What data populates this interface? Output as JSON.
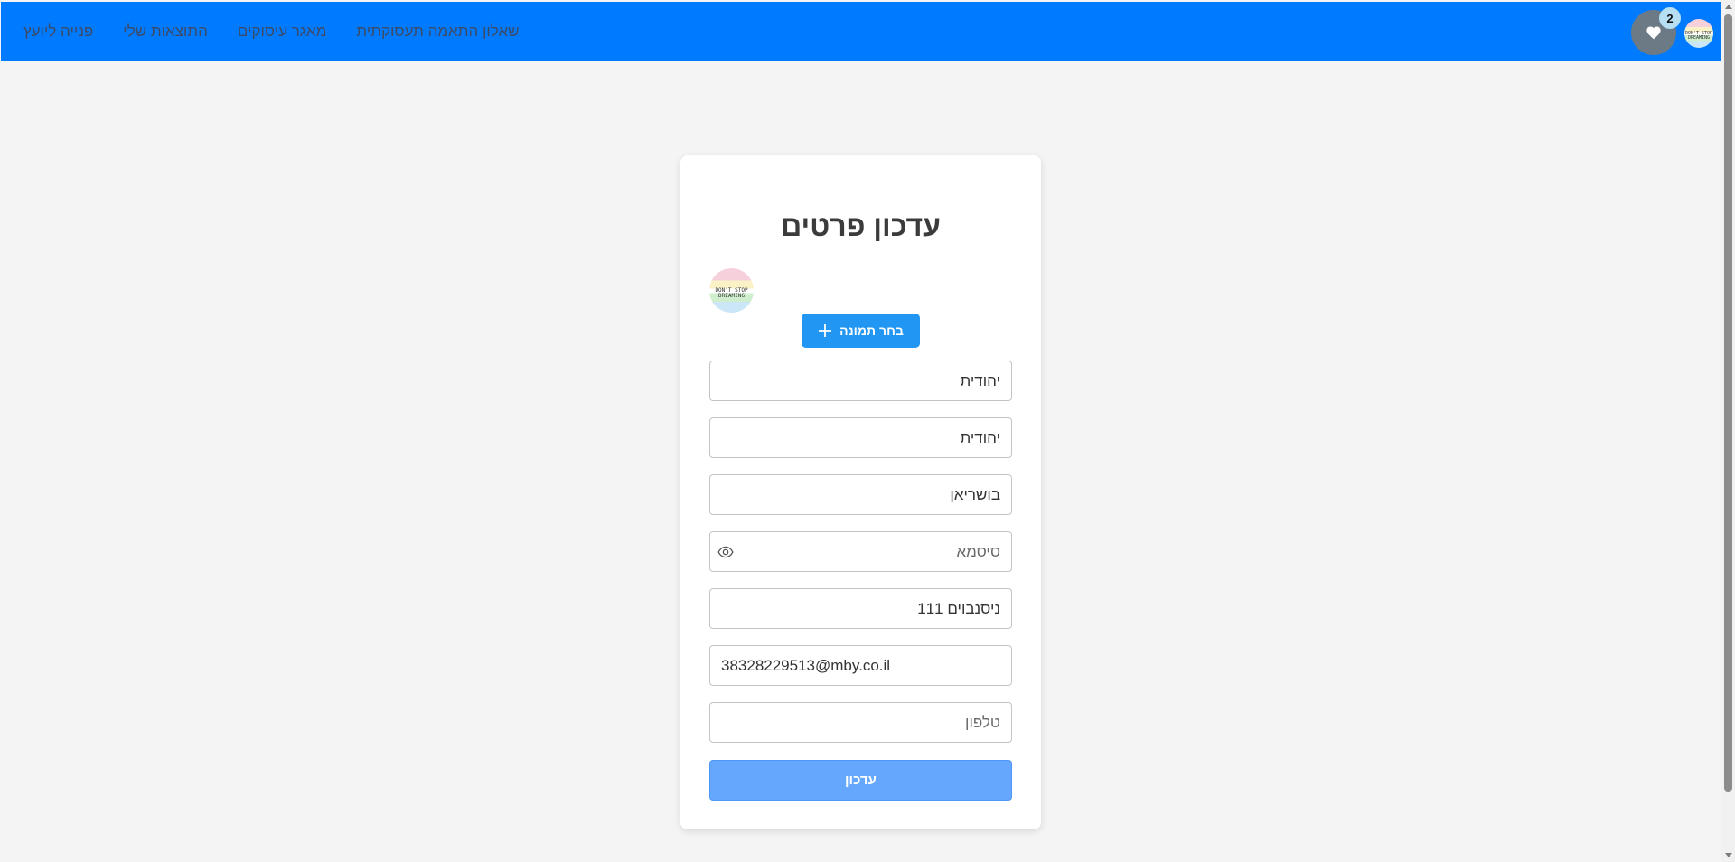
{
  "navbar": {
    "links": [
      "שאלון התאמה תעסוקתית",
      "מאגר עיסוקים",
      "התוצאות שלי",
      "פנייה ליועץ"
    ],
    "favorites_count": "2",
    "avatar_text": "DON'T STOP DREAMING",
    "color": "#007bff"
  },
  "form": {
    "title": "עדכון פרטים",
    "avatar_text": "DON'T STOP DREAMING",
    "choose_image_label": "בחר תמונה",
    "fields": [
      {
        "value": "יהודית",
        "placeholder": ""
      },
      {
        "value": "יהודית",
        "placeholder": ""
      },
      {
        "value": "בושריאן",
        "placeholder": ""
      },
      {
        "value": "",
        "placeholder": "סיסמא"
      },
      {
        "value": "ניסנבוים 111",
        "placeholder": ""
      },
      {
        "value": "38328229513@mby.co.il",
        "placeholder": ""
      },
      {
        "value": "",
        "placeholder": "טלפון"
      }
    ],
    "submit_label": "עדכון",
    "accent_color": "#2196f3"
  },
  "icons": {
    "favorites": "heart-icon",
    "choose_image": "plus-icon",
    "password_toggle": "eye-icon"
  }
}
